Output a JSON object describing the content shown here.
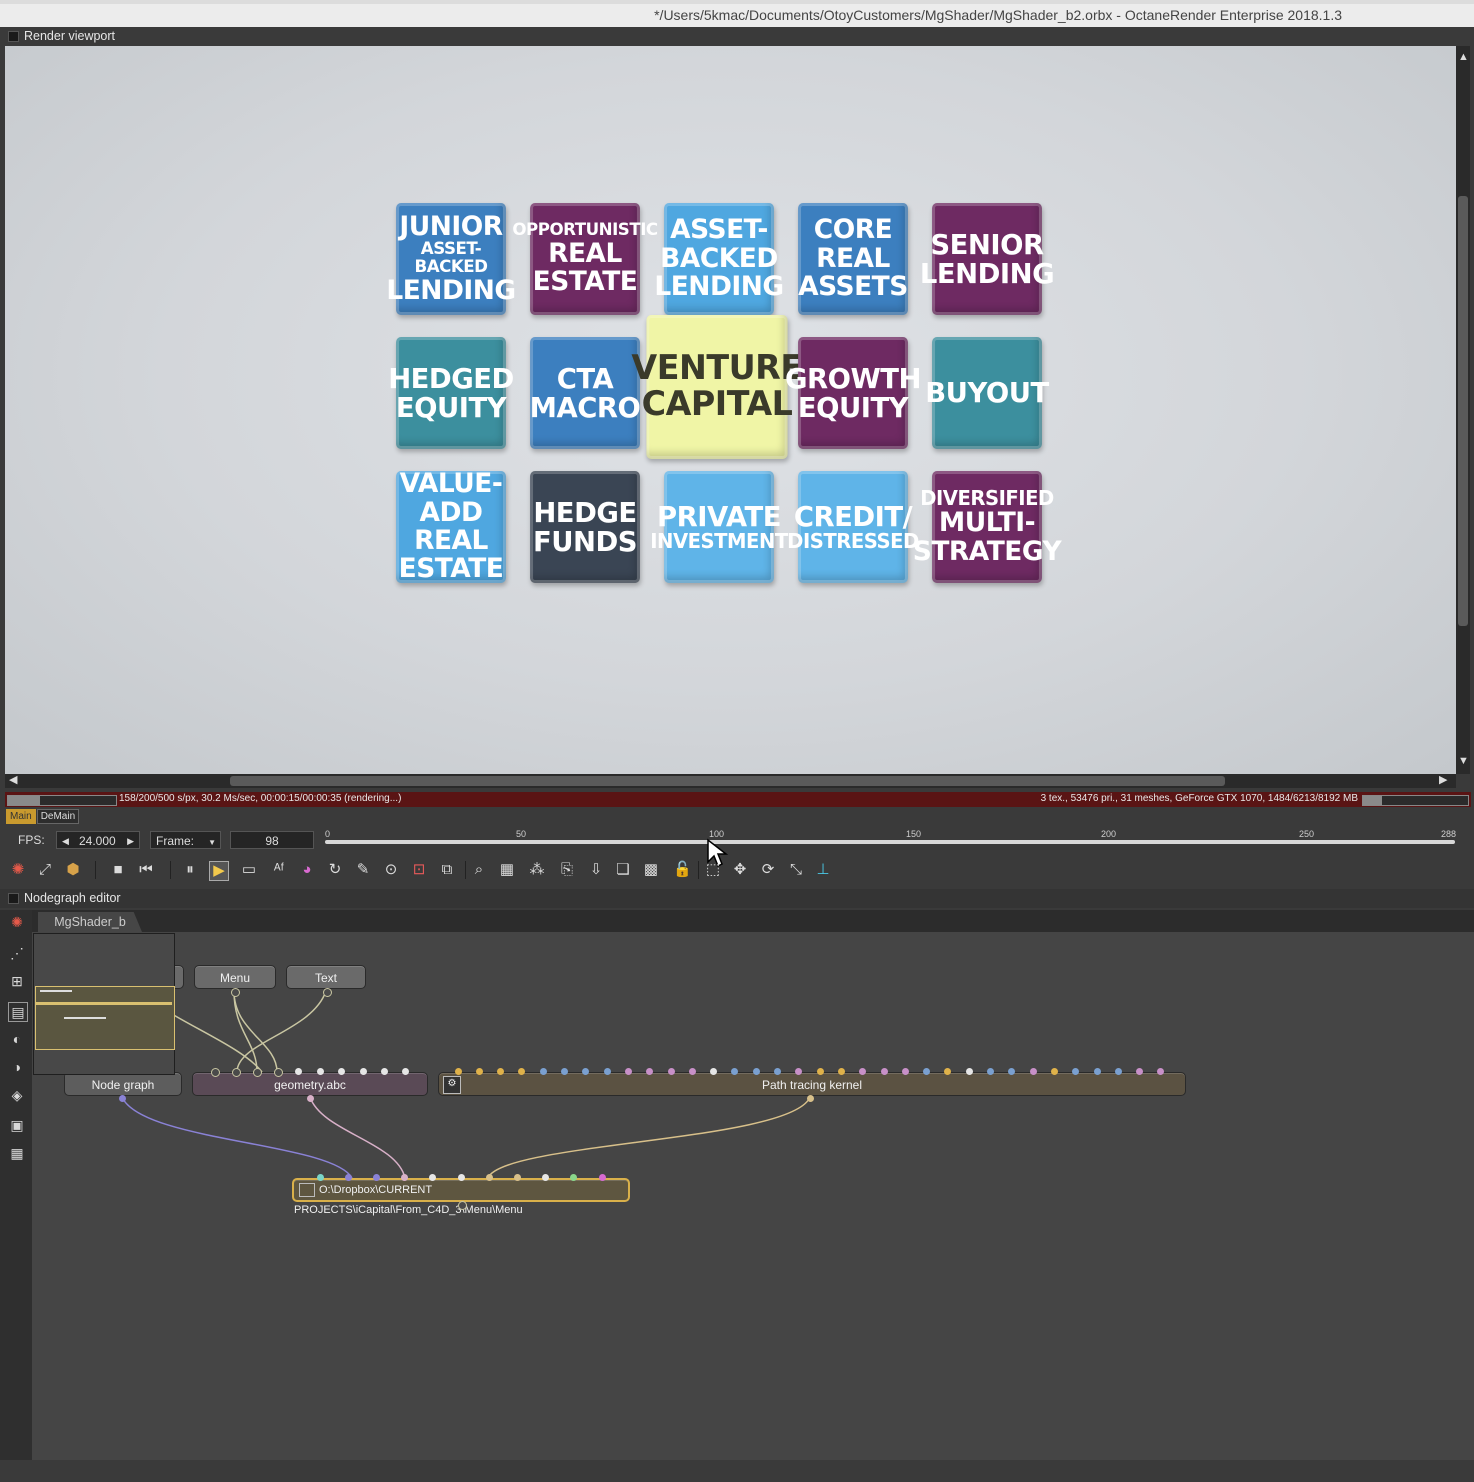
{
  "window": {
    "title": "*/Users/5kmac/Documents/OtoyCustomers/MgShader/MgShader_b2.orbx - OctaneRender Enterprise 2018.1.3"
  },
  "render_viewport": {
    "panel_title": "Render viewport",
    "tiles": [
      {
        "lines": [
          "JUNIOR",
          "ASSET-BACKED",
          "LENDING"
        ],
        "color": "#3c7fbf"
      },
      {
        "lines": [
          "OPPORTUNISTIC",
          "REAL",
          "ESTATE"
        ],
        "color": "#6e2a62"
      },
      {
        "lines": [
          "ASSET-",
          "BACKED",
          "LENDING"
        ],
        "color": "#4fa7e0"
      },
      {
        "lines": [
          "CORE",
          "REAL",
          "ASSETS"
        ],
        "color": "#3c7fbf"
      },
      {
        "lines": [
          "SENIOR",
          "LENDING"
        ],
        "color": "#6e2a62"
      },
      {
        "lines": [
          "HEDGED",
          "EQUITY"
        ],
        "color": "#3c8f9e"
      },
      {
        "lines": [
          "CTA",
          "MACRO"
        ],
        "color": "#3c7fbf"
      },
      {
        "lines": [
          "VENTURE",
          "CAPITAL"
        ],
        "color": "#f0f5a6"
      },
      {
        "lines": [
          "GROWTH",
          "EQUITY"
        ],
        "color": "#6e2a62"
      },
      {
        "lines": [
          "BUYOUT"
        ],
        "color": "#3c8f9e"
      },
      {
        "lines": [
          "VALUE-ADD",
          "REAL",
          "ESTATE"
        ],
        "color": "#4fa7e0"
      },
      {
        "lines": [
          "HEDGE",
          "FUNDS"
        ],
        "color": "#3a4554"
      },
      {
        "lines": [
          "PRIVATE",
          "INVESTMENT"
        ],
        "color": "#5fb4e8"
      },
      {
        "lines": [
          "CREDIT/",
          "DISTRESSED"
        ],
        "color": "#5fb4e8"
      },
      {
        "lines": [
          "DIVERSIFIED",
          "MULTI-",
          "STRATEGY"
        ],
        "color": "#6e2a62"
      }
    ]
  },
  "status": {
    "left_text": "158/200/500 s/px, 30.2 Ms/sec, 00:00:15/00:00:35 (rendering...)",
    "right_text": "3 tex., 53476 pri., 31 meshes, GeForce GTX 1070, 1484/6213/8192 MB",
    "render_progress": 0.3,
    "vram_progress": 0.18
  },
  "mini_tabs": [
    "Main",
    "DeMain"
  ],
  "timeline": {
    "fps_label": "FPS:",
    "fps_value": "24.000",
    "frame_label": "Frame:",
    "frame_value": "98",
    "ticks": [
      "0",
      "50",
      "100",
      "150",
      "200",
      "250",
      "288"
    ]
  },
  "nodegraph": {
    "panel_title": "Nodegraph editor",
    "tab_label": "MgShader_b",
    "nodes": {
      "menu": "Menu",
      "text": "Text",
      "node_graph": "Node graph",
      "geometry": "geometry.abc",
      "kernel": "Path tracing kernel",
      "output": "O:\\Dropbox\\CURRENT PROJECTS\\iCapital\\From_C4D_3\\Menu\\Menu"
    }
  },
  "colors": {
    "status_bar": "#5a1414",
    "accent": "#e0b24a"
  }
}
